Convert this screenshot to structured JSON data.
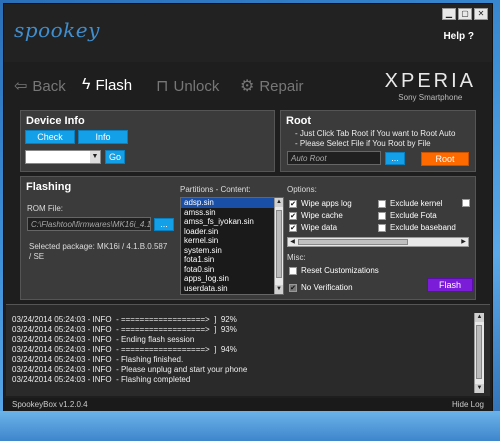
{
  "app": {
    "logo": "spookey"
  },
  "window_buttons": {
    "minimize": "▁",
    "restore": "▢",
    "close": "✕"
  },
  "help": "Help ?",
  "nav": {
    "back": "Back",
    "flash": "Flash",
    "unlock": "Unlock",
    "repair": "Repair"
  },
  "brand": {
    "logo": "XPERIA",
    "sub": "Sony Smartphone"
  },
  "device_info": {
    "title": "Device Info",
    "check": "Check",
    "info": "Info",
    "go": "Go",
    "combo_value": ""
  },
  "root": {
    "title": "Root",
    "note1": "- Just Click Tab Root if You want to Root Auto",
    "note2": "- Please Select File if You Root by File",
    "field_placeholder": "Auto Root",
    "browse": "...",
    "button": "Root"
  },
  "flashing": {
    "title": "Flashing",
    "rom_label": "ROM File:",
    "rom_path": "C:\\Flashtool\\firmwares\\MK16i_4.1",
    "browse": "...",
    "package_line1": "Selected package: MK16i / 4.1.B.0.587",
    "package_line2": "/ SE",
    "partitions_label": "Partitions - Content:",
    "partitions": [
      "adsp.sin",
      "amss.sin",
      "amss_fs_iyokan.sin",
      "loader.sin",
      "kernel.sin",
      "system.sin",
      "fota1.sin",
      "fota0.sin",
      "apps_log.sin",
      "userdata.sin"
    ],
    "options_label": "Options:",
    "options_left": [
      {
        "label": "Wipe apps log",
        "checked": true
      },
      {
        "label": "Wipe cache",
        "checked": true
      },
      {
        "label": "Wipe data",
        "checked": true
      }
    ],
    "options_right": [
      {
        "label": "Exclude kernel",
        "checked": false
      },
      {
        "label": "Exclude Fota",
        "checked": false
      },
      {
        "label": "Exclude baseband",
        "checked": false
      }
    ],
    "misc_label": "Misc:",
    "reset_customizations": {
      "label": "Reset Customizations",
      "checked": false
    },
    "no_verification": {
      "label": "No Verification",
      "checked": true
    },
    "flash_button": "Flash"
  },
  "log": [
    "03/24/2014 05:24:03 - INFO  - ==================>  ]  92%",
    "03/24/2014 05:24:03 - INFO  - ==================>  ]  93%",
    "03/24/2014 05:24:03 - INFO  - Ending flash session",
    "03/24/2014 05:24:03 - INFO  - ==================>  ]  94%",
    "03/24/2014 05:24:03 - INFO  - Flashing finished.",
    "03/24/2014 05:24:03 - INFO  - Please unplug and start your phone",
    "03/24/2014 05:24:03 - INFO  - Flashing completed"
  ],
  "status": {
    "version": "SpookeyBox v1.2.0.4",
    "hide_log": "Hide Log"
  },
  "colors": {
    "accent_blue": "#14a0e8",
    "root_orange": "#ff6a00",
    "flash_purple": "#7a1cd8"
  },
  "icons": {
    "back": "back-arrow-icon",
    "flash": "flash-icon",
    "unlock": "padlock-icon",
    "repair": "gear-icon"
  }
}
